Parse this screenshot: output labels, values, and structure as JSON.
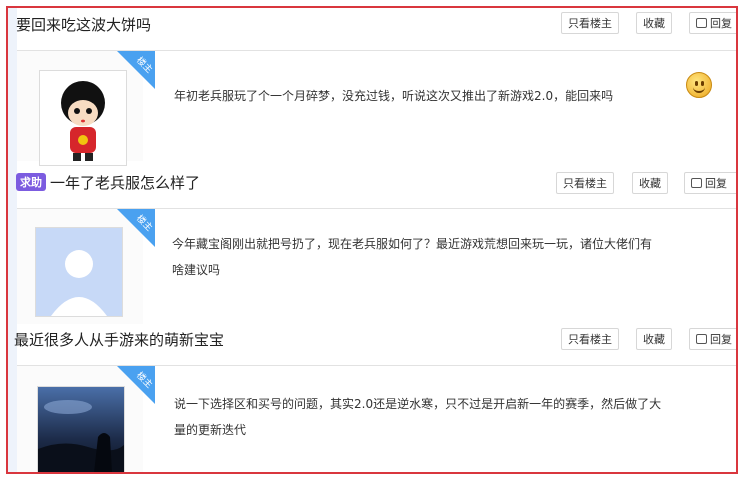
{
  "actions": {
    "only_owner": "只看楼主",
    "favorite": "收藏",
    "reply": "回复"
  },
  "owner_tag": "楼主",
  "threads": [
    {
      "title": "要回来吃这波大饼吗",
      "badge": "",
      "content": "年初老兵服玩了个一个月碎梦，没充过钱，听说这次又推出了新游戏2.0，能回来吗",
      "avatar": "cartoon-doll-avatar",
      "emoji": "smile-emoji"
    },
    {
      "title": "一年了老兵服怎么样了",
      "badge": "求助",
      "content_line1": "今年藏宝阁刚出就把号扔了，现在老兵服如何了？最近游戏荒想回来玩一玩，诸位大佬们有",
      "content_line2": "啥建议吗",
      "avatar": "default-user-avatar"
    },
    {
      "title": "最近很多人从手游来的萌新宝宝",
      "badge": "",
      "content_line1": "说一下选择区和买号的问题，其实2.0还是逆水寒，只不过是开启新一年的赛季，然后做了大",
      "content_line2": "量的更新迭代",
      "avatar": "night-sky-avatar"
    }
  ]
}
